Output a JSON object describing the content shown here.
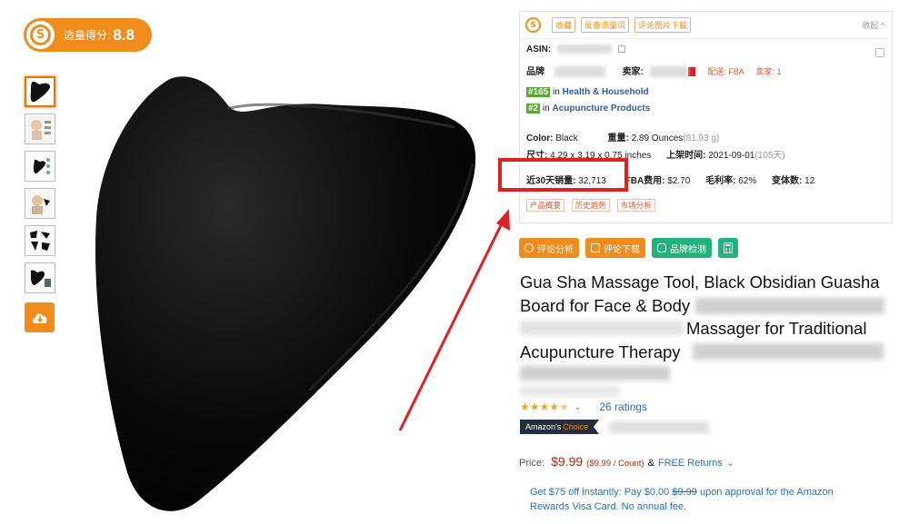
{
  "score": {
    "label": "适量得分:",
    "value": "8.8"
  },
  "panel": {
    "tabs": [
      "收藏",
      "反查流量词",
      "评论图片下载"
    ],
    "collapse_label": "收起 ^",
    "asin_label": "ASIN:",
    "brand_label": "品牌",
    "seller_label": "卖家:",
    "fulfillment": "配送: FBA",
    "seller_count": "卖家: 1",
    "ranks": [
      {
        "num": "#165",
        "prefix": "in",
        "category": "Health & Household"
      },
      {
        "num": "#2",
        "prefix": "in",
        "category": "Acupuncture Products"
      }
    ],
    "color_label": "Color:",
    "color_value": "Black",
    "weight_label": "重量:",
    "weight_value": "2.89 Ounces",
    "weight_grams": "(81.93 g)",
    "size_label": "尺寸:",
    "size_value": "4.29 x 3.19 x 0.75 inches",
    "launch_label": "上架时间:",
    "launch_value": "2021-09-01",
    "launch_days": "(105天)",
    "sales_label": "近30天销量:",
    "sales_value": "32,713",
    "fba_label": "FBA费用:",
    "fba_value": "$2.70",
    "margin_label": "毛利率:",
    "margin_value": "62%",
    "variants_label": "变体数:",
    "variants_value": "12",
    "sub_tabs": [
      "产品概要",
      "历史趋势",
      "市场分析"
    ]
  },
  "actions": [
    "评论分析",
    "评论下载",
    "品牌检测"
  ],
  "product": {
    "title_lines": [
      "Gua Sha Massage Tool, Black Obsidian Guasha",
      "Board for Face & Body",
      "Massager for Traditional",
      "Acupuncture Therapy"
    ],
    "rating_value": 4.5,
    "ratings_text": "26 ratings",
    "choice_prefix": "Amazon's",
    "choice_word": "Choice",
    "price_label": "Price:",
    "price": "$9.99",
    "unit_price": "($9.99 / Count)",
    "amp": "&",
    "returns": "FREE Returns",
    "promo_before": "Get $75 off instantly: Pay $0.00",
    "promo_strike": "$9.99",
    "promo_after": "upon approval for the Amazon Rewards Visa Card. No annual fee."
  },
  "colors": {
    "accent": "#f08c1c",
    "highlight": "#e02020",
    "link": "#2a6fb0",
    "price": "#b12704"
  }
}
